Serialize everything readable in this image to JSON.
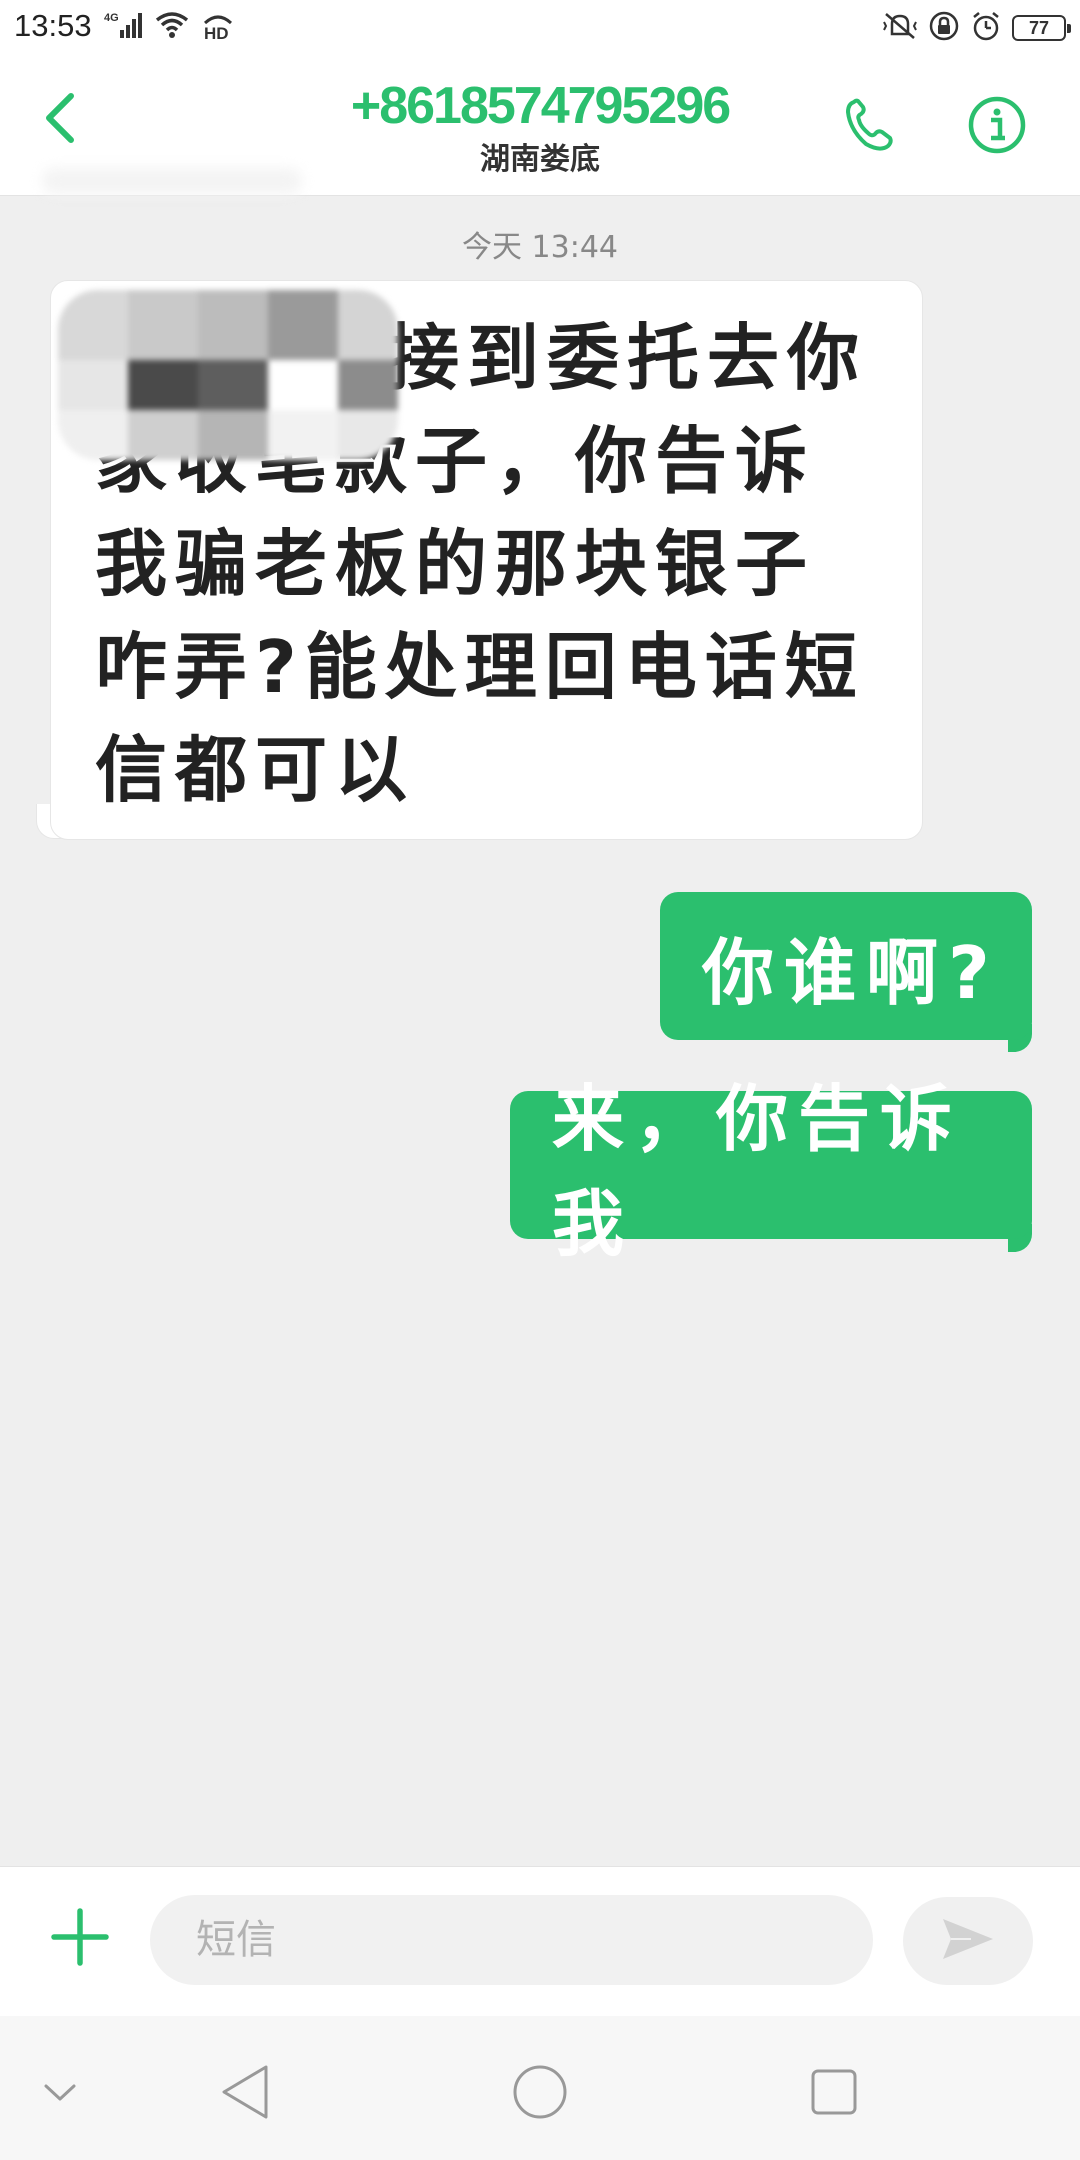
{
  "status_bar": {
    "time": "13:53",
    "network": "4G",
    "hd_label": "HD",
    "battery_level": "77"
  },
  "header": {
    "contact_number": "+8618574795296",
    "location": "湖南娄底"
  },
  "conversation": {
    "timestamp": "今天 13:44",
    "messages": [
      {
        "direction": "incoming",
        "text_visible": "接到委托去你家收笔款子，你告诉我骗老板的那块银子咋弄?能处理回电话短信都可以",
        "redacted_prefix": true
      },
      {
        "direction": "outgoing",
        "text": "你谁啊?"
      },
      {
        "direction": "outgoing",
        "text": "来，你告诉我"
      }
    ]
  },
  "input_bar": {
    "placeholder": "短信",
    "value": ""
  },
  "colors": {
    "accent": "#2bbf6e",
    "background": "#efefef",
    "incoming_bubble": "#ffffff",
    "outgoing_bubble": "#2bbf6e"
  },
  "icons": {
    "back": "chevron-left-icon",
    "call": "phone-icon",
    "info": "info-icon",
    "add": "plus-icon",
    "send": "send-icon",
    "nav_hide": "chevron-down-icon",
    "nav_back": "triangle-back-icon",
    "nav_home": "circle-home-icon",
    "nav_recent": "square-recent-icon"
  }
}
